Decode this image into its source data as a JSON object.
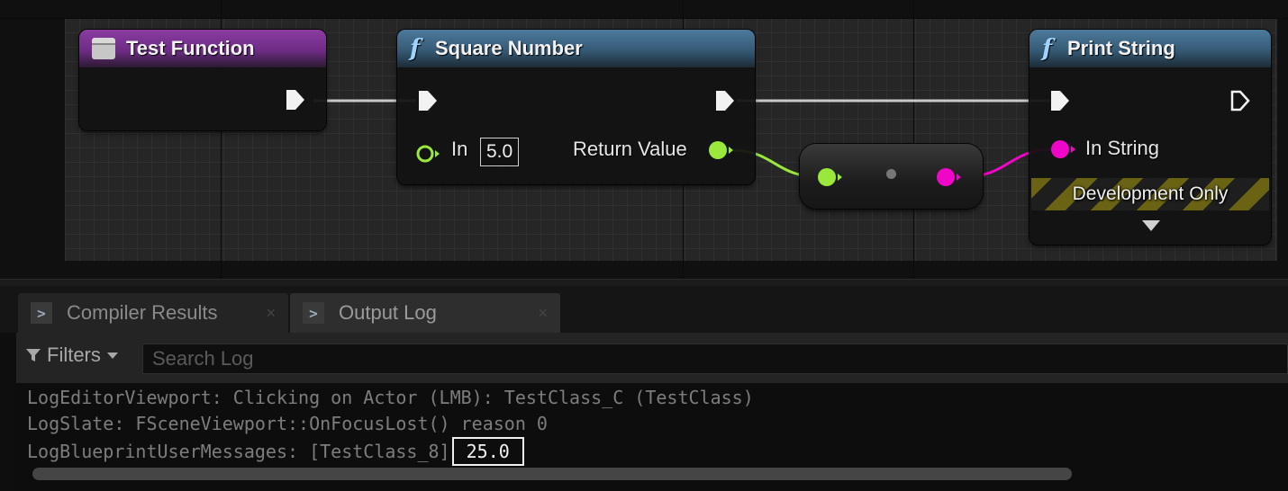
{
  "graph": {
    "nodes": {
      "test_function": {
        "title": "Test Function"
      },
      "square_number": {
        "title": "Square Number",
        "in_label": "In",
        "in_value": "5.0",
        "return_label": "Return Value"
      },
      "print_string": {
        "title": "Print String",
        "in_string_label": "In String",
        "dev_only_label": "Development Only"
      }
    },
    "colors": {
      "exec_wire": "#c8c8c8",
      "float_pin": "#9be83c",
      "string_pin": "#f006c8",
      "function_header": "#365a75",
      "event_header": "#6d2c85"
    },
    "icons": {
      "function": "f",
      "event": "event-icon",
      "tab": "terminal-icon"
    }
  },
  "panel": {
    "tabs": [
      {
        "label": "Compiler Results",
        "close": "×"
      },
      {
        "label": "Output Log",
        "close": "×"
      }
    ],
    "filters_label": "Filters",
    "search_placeholder": "Search Log",
    "log_lines": [
      "LogEditorViewport: Clicking on Actor (LMB): TestClass_C (TestClass)",
      "LogSlate: FSceneViewport::OnFocusLost() reason 0",
      "LogBlueprintUserMessages: [TestClass_8]"
    ],
    "log_highlight": "25.0"
  }
}
